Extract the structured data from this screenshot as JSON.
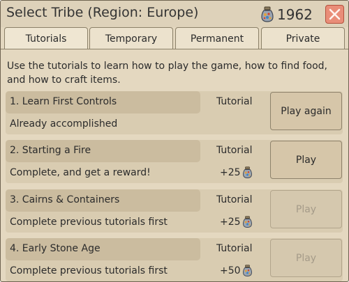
{
  "dialog": {
    "title": "Select Tribe (Region: Europe)",
    "coins": "1962"
  },
  "tabs": [
    {
      "label": "Tutorials",
      "active": true
    },
    {
      "label": "Temporary",
      "active": false
    },
    {
      "label": "Permanent",
      "active": false
    },
    {
      "label": "Private",
      "active": false
    }
  ],
  "intro": "Use the tutorials to learn how to play the game, how to find food, and how to craft items.",
  "tutorials": [
    {
      "title": "1. Learn First Controls",
      "type": "Tutorial",
      "status": "Already accomplished",
      "reward": "",
      "button": "Play again",
      "enabled": true
    },
    {
      "title": "2. Starting a Fire",
      "type": "Tutorial",
      "status": "Complete, and get a reward!",
      "reward": "+25",
      "button": "Play",
      "enabled": true
    },
    {
      "title": "3. Cairns & Containers",
      "type": "Tutorial",
      "status": "Complete previous tutorials first",
      "reward": "+25",
      "button": "Play",
      "enabled": false
    },
    {
      "title": "4. Early Stone Age",
      "type": "Tutorial",
      "status": "Complete previous tutorials first",
      "reward": "+50",
      "button": "Play",
      "enabled": false
    }
  ],
  "colors": {
    "panel_bg": "#e4d8c0",
    "row_bg": "#d9ccb1",
    "title_bar": "#cbbc9f",
    "close_button": "#e98d78",
    "disabled_text": "#a59b89"
  },
  "icons": {
    "currency": "gem-bag-icon",
    "close": "close-icon"
  }
}
